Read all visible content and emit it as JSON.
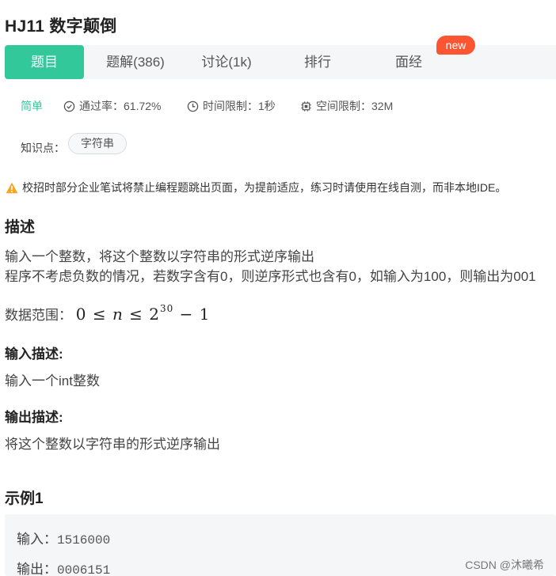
{
  "problem": {
    "title": "HJ11  数字颠倒"
  },
  "tabs": [
    {
      "label": "题目",
      "active": true
    },
    {
      "label": "题解(386)"
    },
    {
      "label": "讨论(1k)"
    },
    {
      "label": "排行"
    },
    {
      "label": "面经",
      "badge": "new"
    }
  ],
  "meta": {
    "difficulty": "简单",
    "pass_rate": "通过率：61.72%",
    "time_limit": "时间限制：1秒",
    "space_limit": "空间限制：32M"
  },
  "knowledge": {
    "label": "知识点：",
    "tags": [
      "字符串"
    ]
  },
  "warning": "校招时部分企业笔试将禁止编程题跳出页面，为提前适应，练习时请使用在线自测，而非本地IDE。",
  "description": {
    "heading": "描述",
    "lines": [
      "输入一个整数，将这个整数以字符串的形式逆序输出",
      "程序不考虑负数的情况，若数字含有0，则逆序形式也含有0，如输入为100，则输出为001"
    ],
    "range_label": "数据范围：",
    "range_formula": "0 ≤ n ≤ 2^30 − 1"
  },
  "input_desc": {
    "heading": "输入描述:",
    "text": "输入一个int整数"
  },
  "output_desc": {
    "heading": "输出描述:",
    "text": "将这个整数以字符串的形式逆序输出"
  },
  "example": {
    "heading": "示例1",
    "input_label": "输入：",
    "input_value": "1516000",
    "output_label": "输出：",
    "output_value": "0006151"
  },
  "watermark": "CSDN @沐曦希",
  "colors": {
    "accent": "#32c89a",
    "badge": "#fc5531",
    "warning": "#f5a623"
  }
}
